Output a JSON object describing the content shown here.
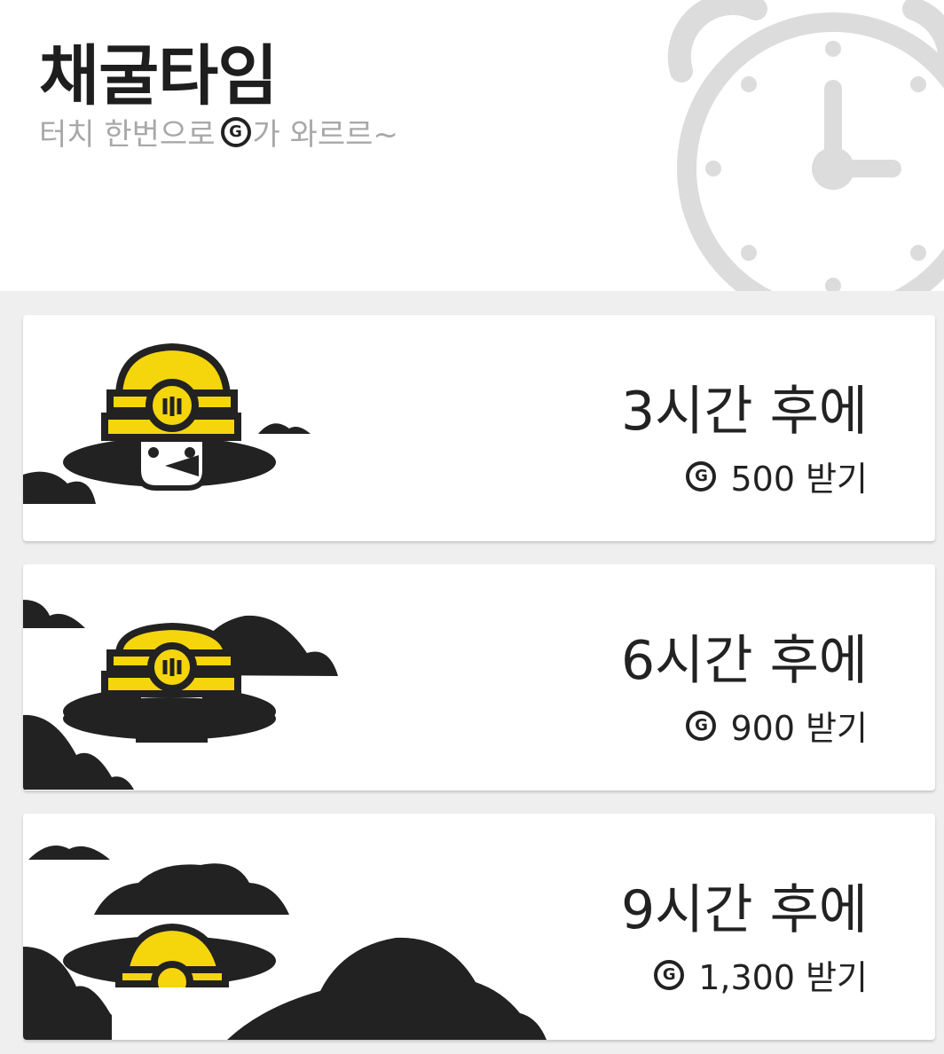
{
  "header": {
    "title": "채굴타임",
    "subtitle_before": "터치 한번으로 ",
    "subtitle_after": "가 와르르~",
    "coin_icon": "g-coin-icon",
    "decor_icon": "alarm-clock-icon"
  },
  "cards": [
    {
      "hours_label": "3시간 후에",
      "reward_label": "500 받기",
      "icon": "miner-icon"
    },
    {
      "hours_label": "6시간 후에",
      "reward_label": "900 받기",
      "icon": "miner-icon"
    },
    {
      "hours_label": "9시간 후에",
      "reward_label": "1,300 받기",
      "icon": "miner-icon"
    }
  ],
  "colors": {
    "accent_yellow": "#f5d50c",
    "dark": "#222222",
    "subtitle_gray": "#a8a8a8",
    "background": "#efefef"
  }
}
